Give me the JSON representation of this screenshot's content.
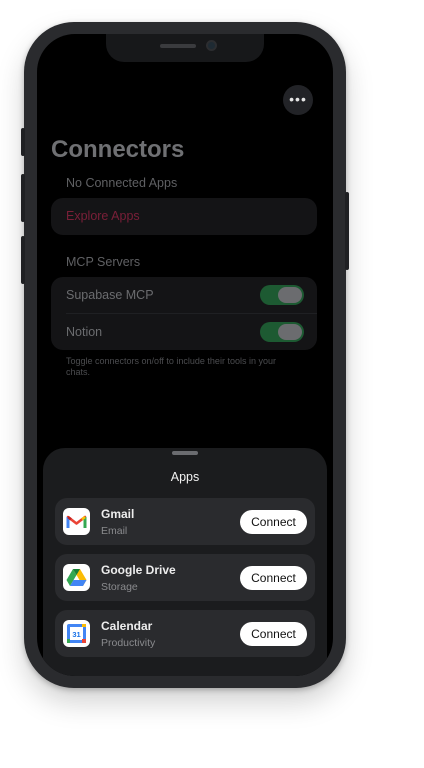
{
  "header": {
    "title": "Connectors",
    "more_icon": "ellipsis-icon",
    "more_glyph": "•••"
  },
  "connected_apps": {
    "label": "No Connected Apps",
    "explore_label": "Explore Apps",
    "explore_color": "#7a1f38"
  },
  "mcp": {
    "label": "MCP Servers",
    "servers": [
      {
        "name": "Supabase MCP",
        "enabled": true
      },
      {
        "name": "Notion",
        "enabled": true
      }
    ],
    "toggle_on_color": "#1d5a32",
    "footnote": "Toggle connectors on/off to include their tools in your chats."
  },
  "apps_sheet": {
    "title": "Apps",
    "apps": [
      {
        "name": "Gmail",
        "category": "Email",
        "icon": "gmail-icon",
        "button": "Connect"
      },
      {
        "name": "Google Drive",
        "category": "Storage",
        "icon": "google-drive-icon",
        "button": "Connect"
      },
      {
        "name": "Calendar",
        "category": "Productivity",
        "icon": "google-calendar-icon",
        "button": "Connect",
        "icon_text": "31"
      }
    ]
  }
}
